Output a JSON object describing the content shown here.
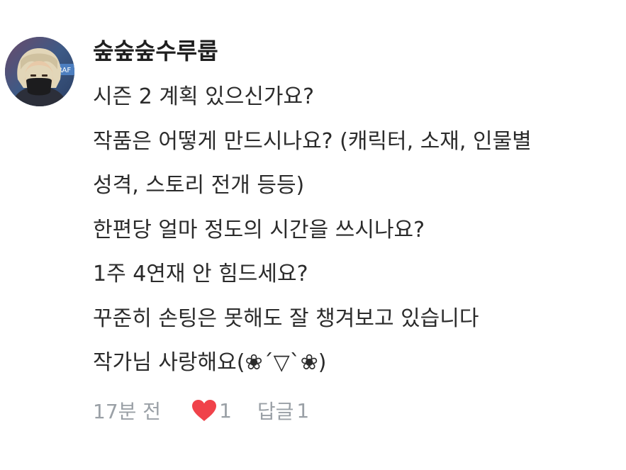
{
  "comment": {
    "username": "숲숲숲수루룹",
    "lines": [
      "시즌 2 계획 있으신가요?",
      "작품은 어떻게 만드시나요? (캐릭터, 소재, 인물별",
      "성격, 스토리 전개 등등)",
      "한편당 얼마 정도의 시간을 쓰시나요?",
      "1주 4연재 안 힘드세요?",
      "꾸준히 손팅은 못해도 잘 챙겨보고 있습니다",
      "작가님 사랑해요(❀´▽`❀)"
    ],
    "time": "17분 전",
    "like_count": "1",
    "reply_label": "답글",
    "reply_count": "1"
  },
  "colors": {
    "text": "#2b2b2b",
    "meta": "#9aa0a6",
    "heart": "#f0424a"
  },
  "icons": {
    "avatar": "user-avatar-photo",
    "like": "heart-icon"
  }
}
